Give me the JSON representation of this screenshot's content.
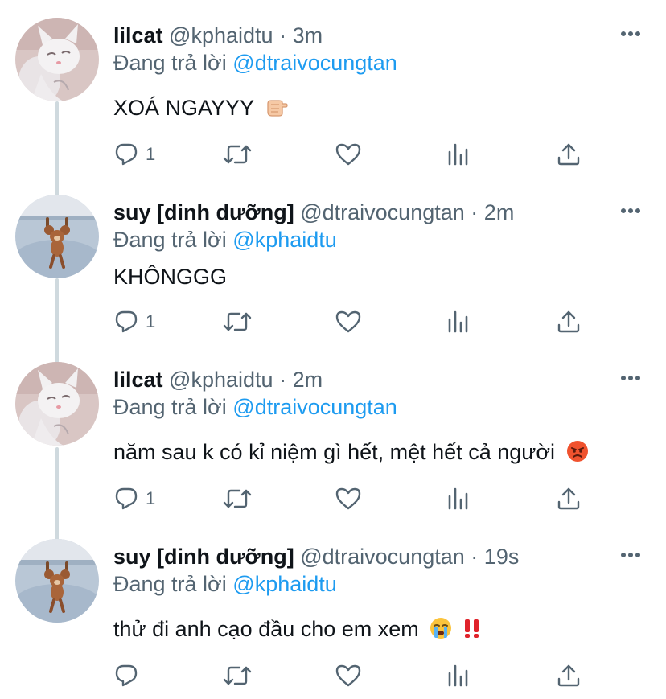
{
  "tweets": [
    {
      "name": "lilcat",
      "handle": "@kphaidtu",
      "separator": "·",
      "time": "3m",
      "replying_prefix": "Đang trả lời",
      "replying_to": "@dtraivocungtan",
      "text": "XOÁ NGAYYY",
      "emoji": [
        "backhand-index-pointing-icon"
      ],
      "avatar": "white-cat-avatar",
      "reply_count": "1"
    },
    {
      "name": "suy [dinh dưỡng]",
      "handle": "@dtraivocungtan",
      "separator": "·",
      "time": "2m",
      "replying_prefix": "Đang trả lời",
      "replying_to": "@kphaidtu",
      "text": "KHÔNGGG",
      "emoji": [],
      "avatar": "jerry-mouse-avatar",
      "reply_count": "1"
    },
    {
      "name": "lilcat",
      "handle": "@kphaidtu",
      "separator": "·",
      "time": "2m",
      "replying_prefix": "Đang trả lời",
      "replying_to": "@dtraivocungtan",
      "text": "năm sau k có kỉ niệm gì hết, mệt hết cả người",
      "emoji": [
        "angry-face-icon"
      ],
      "avatar": "white-cat-avatar",
      "reply_count": "1"
    },
    {
      "name": "suy [dinh dưỡng]",
      "handle": "@dtraivocungtan",
      "separator": "·",
      "time": "19s",
      "replying_prefix": "Đang trả lời",
      "replying_to": "@kphaidtu",
      "text": "thử đi anh cạo đầu cho em xem",
      "emoji": [
        "crying-face-icon",
        "double-exclamation-icon"
      ],
      "avatar": "jerry-mouse-avatar",
      "reply_count": ""
    }
  ],
  "colors": {
    "text": "#0f1419",
    "secondary": "#536471",
    "accent": "#1d9bf0",
    "thread_line": "#cfd9de"
  },
  "icons": {
    "more": "more-dots-icon",
    "reply": "reply-bubble-icon",
    "retweet": "retweet-icon",
    "like": "heart-icon",
    "analytics": "analytics-bars-icon",
    "share": "share-upload-icon"
  }
}
